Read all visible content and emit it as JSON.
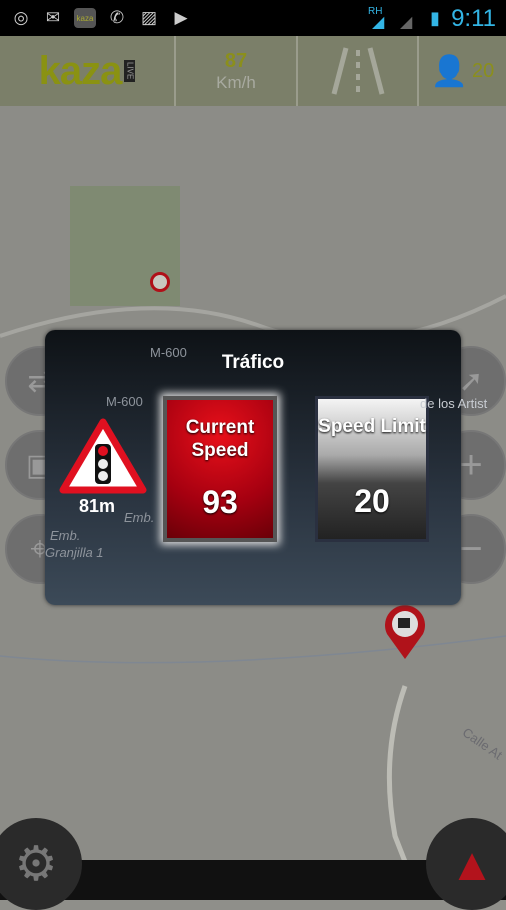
{
  "status_bar": {
    "icons": [
      "gps-icon",
      "gmail-icon",
      "kaza-app-icon",
      "whatsapp-icon",
      "gallery-icon",
      "play-store-icon"
    ],
    "network": "RH",
    "time": "9:11"
  },
  "top_bar": {
    "logo": "kaza",
    "logo_badge": "LIVE",
    "speed": "87",
    "speed_unit": "Km/h",
    "users": "20"
  },
  "map": {
    "labels": [
      "M-600",
      "M-600",
      "Emb.",
      "Emb.",
      "Granjilla 1",
      "de los Artist",
      "Calle At"
    ]
  },
  "dialog": {
    "title": "Tráfico",
    "distance": "81m",
    "current_speed_label": "Current Speed",
    "current_speed": "93",
    "speed_limit_label": "Speed Limit",
    "speed_limit": "20"
  },
  "colors": {
    "accent": "#8a9212",
    "danger": "#d0101a",
    "status_blue": "#33b5e5"
  }
}
